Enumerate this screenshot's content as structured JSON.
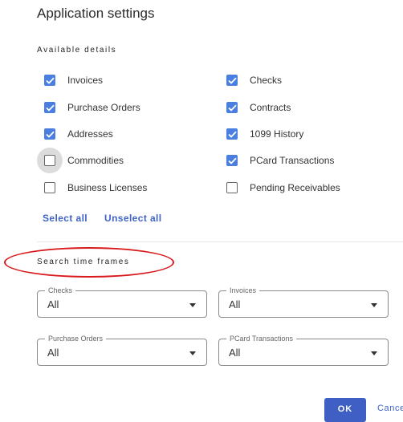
{
  "dialog": {
    "title": "Application settings"
  },
  "available_details": {
    "heading": "Available details",
    "left": [
      {
        "label": "Invoices",
        "checked": true
      },
      {
        "label": "Purchase Orders",
        "checked": true
      },
      {
        "label": "Addresses",
        "checked": true
      },
      {
        "label": "Commodities",
        "checked": false
      },
      {
        "label": "Business Licenses",
        "checked": false
      }
    ],
    "right": [
      {
        "label": "Checks",
        "checked": true
      },
      {
        "label": "Contracts",
        "checked": true
      },
      {
        "label": "1099 History",
        "checked": true
      },
      {
        "label": "PCard Transactions",
        "checked": true
      },
      {
        "label": "Pending Receivables",
        "checked": false
      }
    ],
    "select_all": "Select all",
    "unselect_all": "Unselect all"
  },
  "search_time_frames": {
    "heading": "Search time frames",
    "fields": [
      {
        "label": "Checks",
        "value": "All"
      },
      {
        "label": "Invoices",
        "value": "All"
      },
      {
        "label": "Purchase Orders",
        "value": "All"
      },
      {
        "label": "PCard Transactions",
        "value": "All"
      }
    ]
  },
  "actions": {
    "ok": "OK",
    "cancel": "Cancel"
  },
  "colors": {
    "accent": "#3f5fc5",
    "checkbox_checked": "#4a7ee0",
    "annotation": "#d9191c"
  }
}
